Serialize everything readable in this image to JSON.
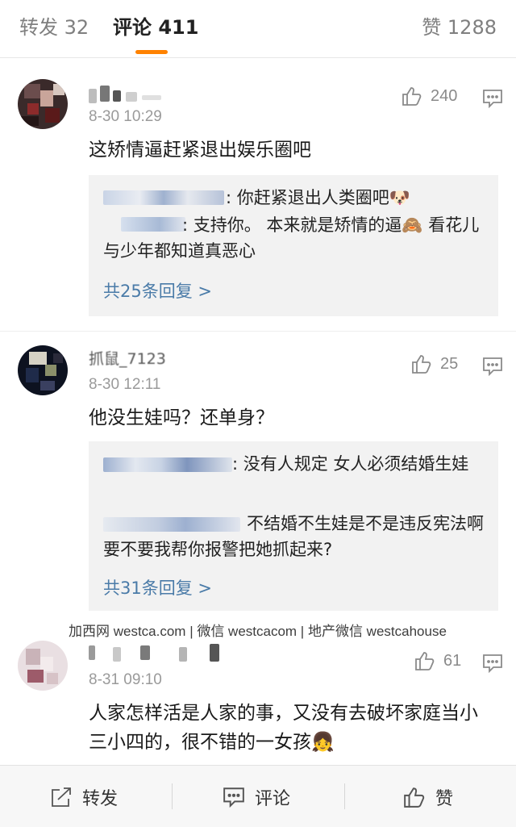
{
  "tabs": {
    "repost": "转发 32",
    "comments": "评论 411",
    "likes": "赞 1288"
  },
  "comments": [
    {
      "time": "8-30 10:29",
      "likes": "240",
      "text": "这矫情逼赶紧退出娱乐圈吧",
      "replies": [
        {
          "text": ": 你赶紧退出人类圈吧🐶"
        },
        {
          "text": ": 支持你。  本来就是矫情的逼🙈 看花儿与少年都知道真恶心"
        }
      ],
      "more": "共25条回复 >"
    },
    {
      "name_fragment": "抓鼠_7123",
      "time": "8-30 12:11",
      "likes": "25",
      "text": "他没生娃吗？还单身？",
      "replies": [
        {
          "text": ": 没有人规定  女人必须结婚生娃"
        },
        {
          "text": "不结婚不生娃是不是违反宪法啊 要不要我帮你报警把她抓起来?"
        }
      ],
      "more": "共31条回复 >"
    },
    {
      "time": "8-31 09:10",
      "likes": "61",
      "text": "人家怎样活是人家的事，又没有去破坏家庭当小三小四的，很不错的一女孩👧"
    }
  ],
  "watermark": "加西网 westca.com | 微信 westcacom | 地产微信 westcahouse",
  "bottom_bar": {
    "repost": "转发",
    "comment": "评论",
    "like": "赞"
  },
  "colors": {
    "accent_orange": "#ff8200",
    "link_blue": "#4a7ba8",
    "gray_text": "#9a9a9a"
  }
}
